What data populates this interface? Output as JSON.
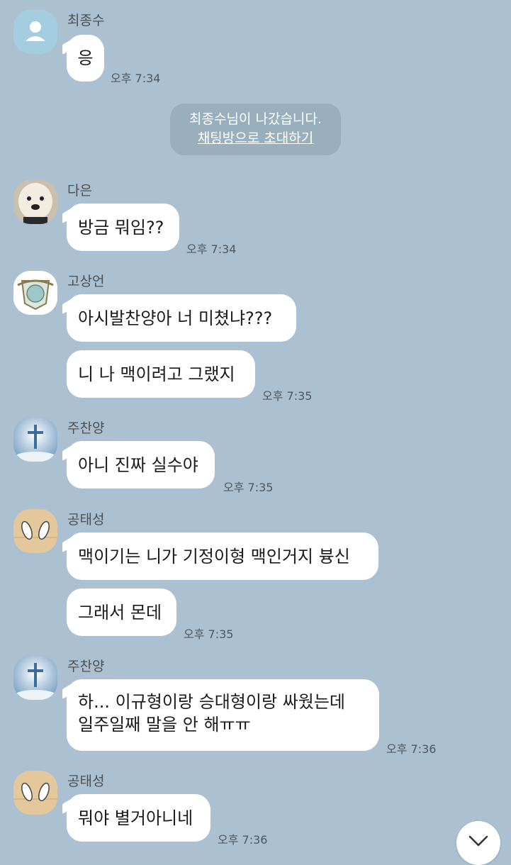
{
  "messages": [
    {
      "sender": "최종수",
      "avatar": "default-profile-icon",
      "lines": [
        "응"
      ],
      "time": "오후 7:34"
    },
    {
      "sender": "다은",
      "avatar": "puppy-avatar",
      "lines": [
        "방금 뭐임??"
      ],
      "time": "오후 7:34"
    },
    {
      "sender": "고상언",
      "avatar": "emblem-avatar",
      "lines": [
        "아시발찬양아 너 미쳤냐???"
      ]
    },
    {
      "lines": [
        "니 나 맥이려고 그랬지"
      ],
      "time": "오후 7:35"
    },
    {
      "sender": "주찬양",
      "avatar": "cross-avatar",
      "lines": [
        "아니 진짜 실수야"
      ],
      "time": "오후 7:35"
    },
    {
      "sender": "공태성",
      "avatar": "feet-avatar",
      "lines": [
        "맥이기는 니가 기정이형 맥인거지 븅신"
      ]
    },
    {
      "lines": [
        "그래서 몬데"
      ],
      "time": "오후 7:35"
    },
    {
      "sender": "주찬양",
      "avatar": "cross-avatar",
      "lines": [
        "하... 이규형이랑 승대형이랑 싸웠는데",
        "일주일째 말을 안 해ㅠㅠ"
      ],
      "time": "오후 7:36"
    },
    {
      "sender": "공태성",
      "avatar": "feet-avatar",
      "lines": [
        "뭐야 별거아니네"
      ],
      "time": "오후 7:36"
    }
  ],
  "system_notice": {
    "text": "최종수님이 나갔습니다.",
    "link": "채팅방으로 초대하기"
  },
  "scroll_button_icon": "chevron-down-icon"
}
